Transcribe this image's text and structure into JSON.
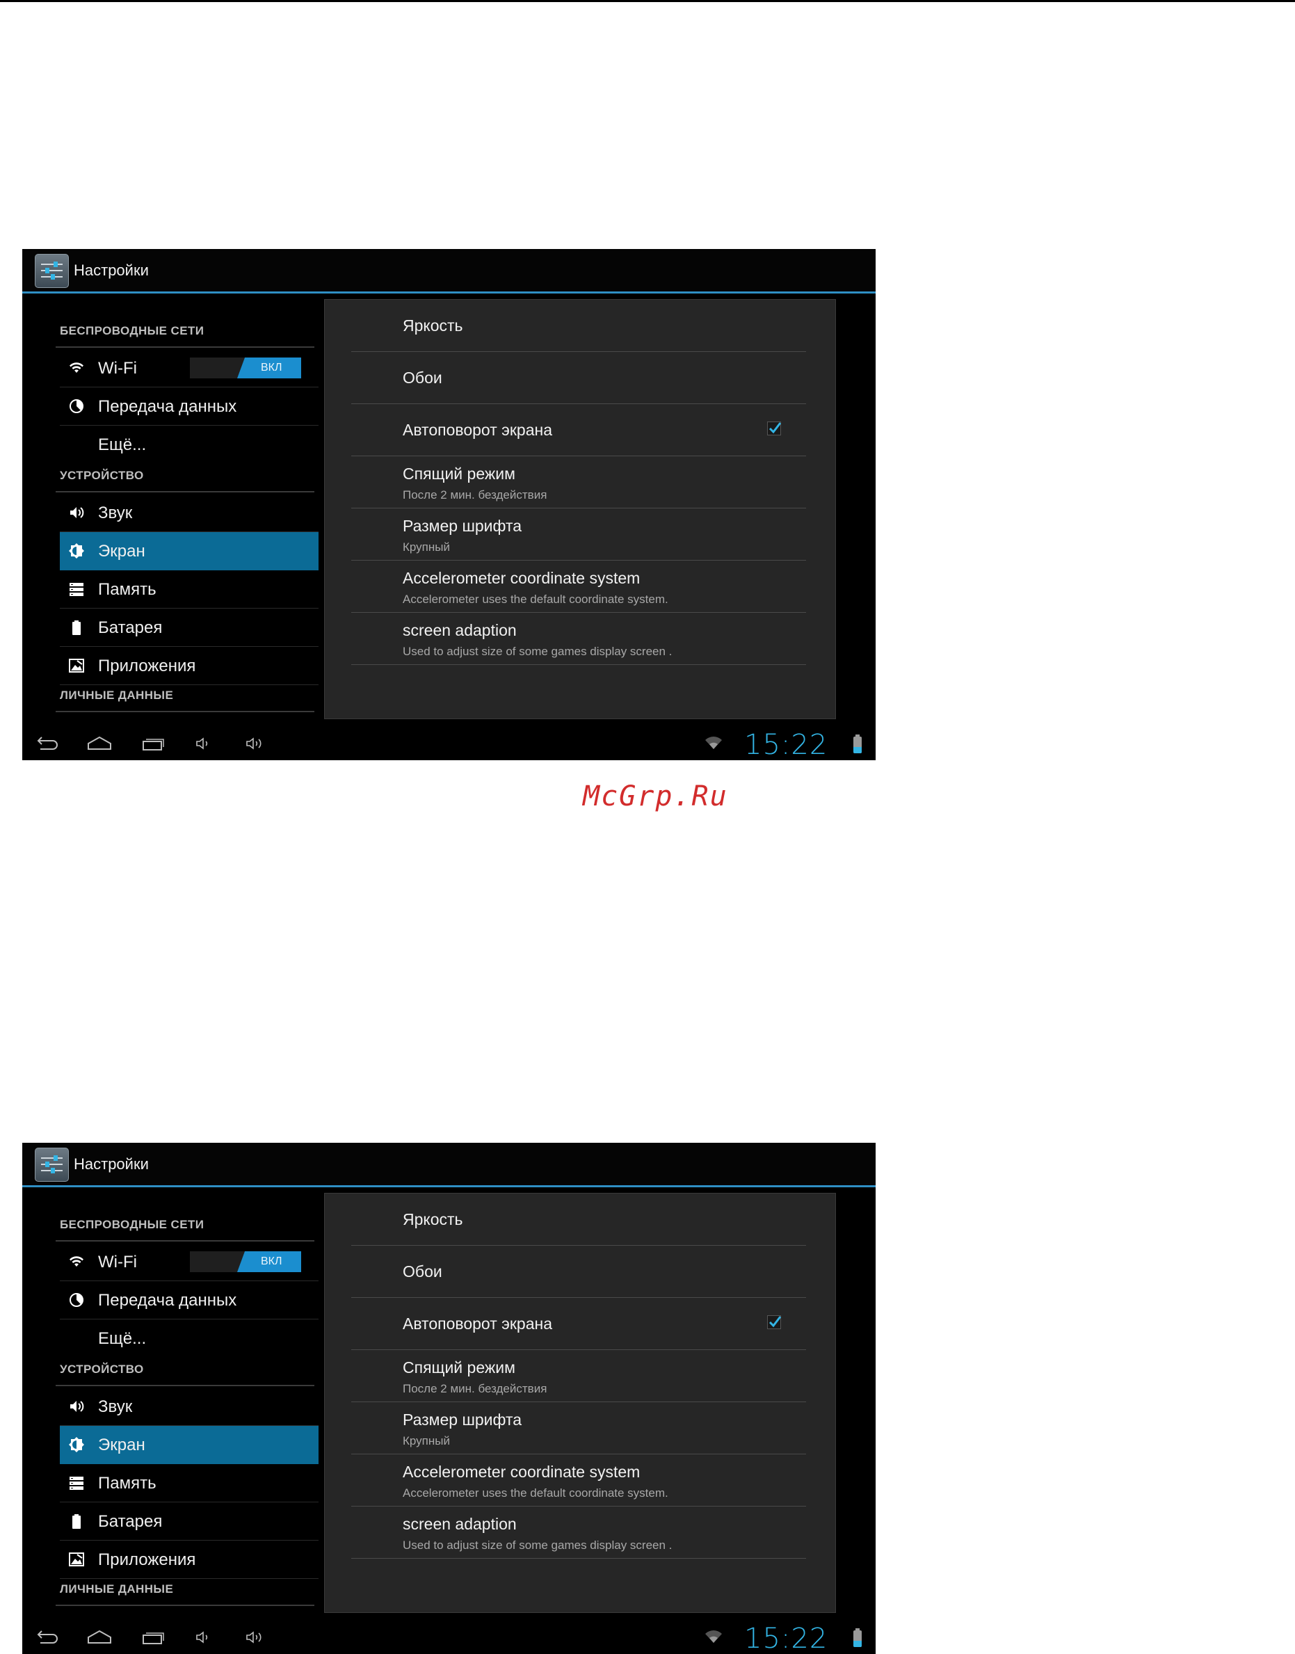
{
  "watermark": "McGrp.Ru",
  "screens": [
    {
      "app_title": "Настройки",
      "sections": [
        {
          "header": "БЕСПРОВОДНЫЕ СЕТИ"
        },
        {
          "header": "УСТРОЙСТВО"
        },
        {
          "header": "ЛИЧНЫЕ ДАННЫЕ"
        }
      ],
      "nav": [
        {
          "label": "Wi-Fi",
          "icon": "wifi-icon",
          "toggle": "ВКЛ"
        },
        {
          "label": "Передача данных",
          "icon": "data-usage-icon"
        },
        {
          "label": "Ещё..."
        },
        {
          "label": "Звук",
          "icon": "sound-icon"
        },
        {
          "label": "Экран",
          "icon": "display-icon",
          "selected": true
        },
        {
          "label": "Память",
          "icon": "storage-icon"
        },
        {
          "label": "Батарея",
          "icon": "battery-icon"
        },
        {
          "label": "Приложения",
          "icon": "apps-icon"
        }
      ],
      "prefs": [
        {
          "title": "Яркость"
        },
        {
          "title": "Обои"
        },
        {
          "title": "Автоповорот экрана",
          "checked": true
        },
        {
          "title": "Спящий режим",
          "summary": "После 2 мин. бездействия"
        },
        {
          "title": "Размер шрифта",
          "summary": "Крупный"
        },
        {
          "title": "Accelerometer coordinate system",
          "summary": "Accelerometer uses the default coordinate system."
        },
        {
          "title": "screen adaption",
          "summary": "Used to adjust size of some games display screen ."
        }
      ],
      "clock": "15:22",
      "accent": "#33b5e5",
      "selected_bg": "#0b6b96"
    },
    {
      "app_title": "Настройки",
      "sections": [
        {
          "header": "БЕСПРОВОДНЫЕ СЕТИ"
        },
        {
          "header": "УСТРОЙСТВО"
        },
        {
          "header": "ЛИЧНЫЕ ДАННЫЕ"
        }
      ],
      "nav": [
        {
          "label": "Wi-Fi",
          "icon": "wifi-icon",
          "toggle": "ВКЛ"
        },
        {
          "label": "Передача данных",
          "icon": "data-usage-icon"
        },
        {
          "label": "Ещё..."
        },
        {
          "label": "Звук",
          "icon": "sound-icon"
        },
        {
          "label": "Экран",
          "icon": "display-icon",
          "selected": true
        },
        {
          "label": "Память",
          "icon": "storage-icon"
        },
        {
          "label": "Батарея",
          "icon": "battery-icon"
        },
        {
          "label": "Приложения",
          "icon": "apps-icon"
        }
      ],
      "prefs": [
        {
          "title": "Яркость"
        },
        {
          "title": "Обои"
        },
        {
          "title": "Автоповорот экрана",
          "checked": true
        },
        {
          "title": "Спящий режим",
          "summary": "После 2 мин. бездействия"
        },
        {
          "title": "Размер шрифта",
          "summary": "Крупный"
        },
        {
          "title": "Accelerometer coordinate system",
          "summary": "Accelerometer uses the default coordinate system."
        },
        {
          "title": "screen adaption",
          "summary": "Used to adjust size of some games display screen ."
        }
      ],
      "clock": "15:22",
      "accent": "#33b5e5",
      "selected_bg": "#0b6b96"
    }
  ]
}
